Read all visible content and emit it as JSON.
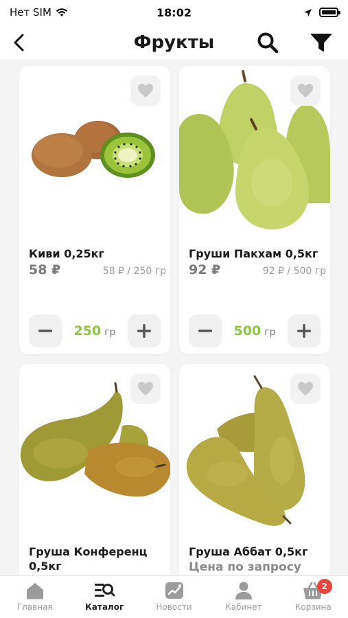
{
  "status_bar": {
    "carrier": "Нет SIM",
    "time": "18:02"
  },
  "nav": {
    "title": "Фрукты",
    "back_icon": "chevron-left-icon",
    "search_icon": "search-icon",
    "filter_icon": "filter-icon"
  },
  "colors": {
    "accent_green": "#8cc63f",
    "badge_red": "#e8453c"
  },
  "products": [
    {
      "name": "Киви 0,25кг",
      "price": "58 ₽",
      "unit_price": "58 ₽ / 250 гр",
      "quantity": "250",
      "quantity_unit": "гр"
    },
    {
      "name": "Груши Пакхам 0,5кг",
      "price": "92 ₽",
      "unit_price": "92 ₽ / 500 гр",
      "quantity": "500",
      "quantity_unit": "гр"
    },
    {
      "name": "Груша Конференц 0,5кг"
    },
    {
      "name": "Груша Аббат 0,5кг",
      "price_note": "Цена по запросу"
    }
  ],
  "tabs": [
    {
      "label": "Главная",
      "icon": "home-icon"
    },
    {
      "label": "Каталог",
      "icon": "catalog-search-icon"
    },
    {
      "label": "Новости",
      "icon": "news-chart-icon"
    },
    {
      "label": "Кабинет",
      "icon": "user-icon"
    },
    {
      "label": "Корзина",
      "icon": "basket-icon",
      "badge": "2"
    }
  ]
}
